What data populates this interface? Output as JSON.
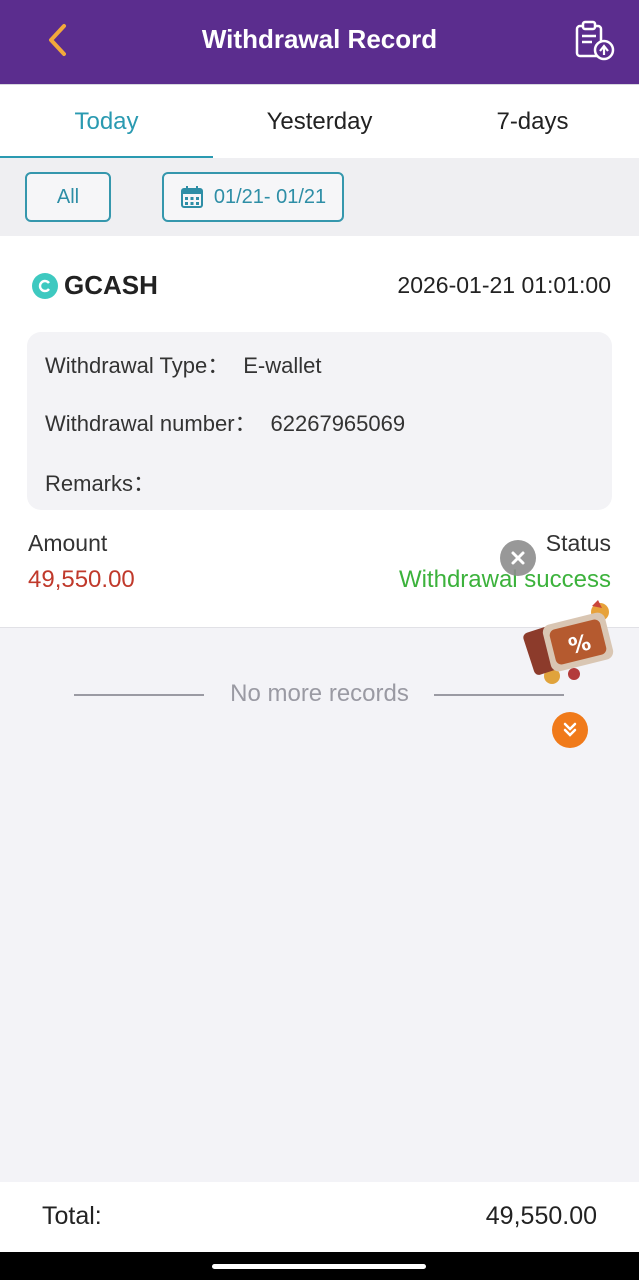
{
  "header": {
    "title": "Withdrawal Record",
    "back_icon": "chevron-left-icon",
    "action_icon": "clipboard-upload-icon",
    "background": "#5b2d8e"
  },
  "tabs": [
    {
      "label": "Today",
      "active": true
    },
    {
      "label": "Yesterday",
      "active": false
    },
    {
      "label": "7-days",
      "active": false
    }
  ],
  "filters": {
    "all_label": "All",
    "date_range": "01/21- 01/21",
    "date_icon": "calendar-icon"
  },
  "record": {
    "method": "GCASH",
    "datetime": "2026-01-21 01:01:00",
    "type_label": "Withdrawal Type：",
    "type_value": "E-wallet",
    "number_label": "Withdrawal number：",
    "number_value": "62267965069",
    "remarks_label": "Remarks：",
    "remarks_value": "",
    "amount_label": "Amount",
    "amount_value": "49,550.00",
    "status_label": "Status",
    "status_value": "Withdrawal success",
    "amount_color": "#c0392b",
    "status_color": "#3cb23c"
  },
  "list_end": {
    "text": "No more records"
  },
  "footer": {
    "total_label": "Total:",
    "total_value": "49,550.00"
  },
  "overlays": {
    "close_icon": "close-icon",
    "promo_icon": "promo-gift-icon",
    "scroll_icon": "double-chevron-down-icon"
  }
}
